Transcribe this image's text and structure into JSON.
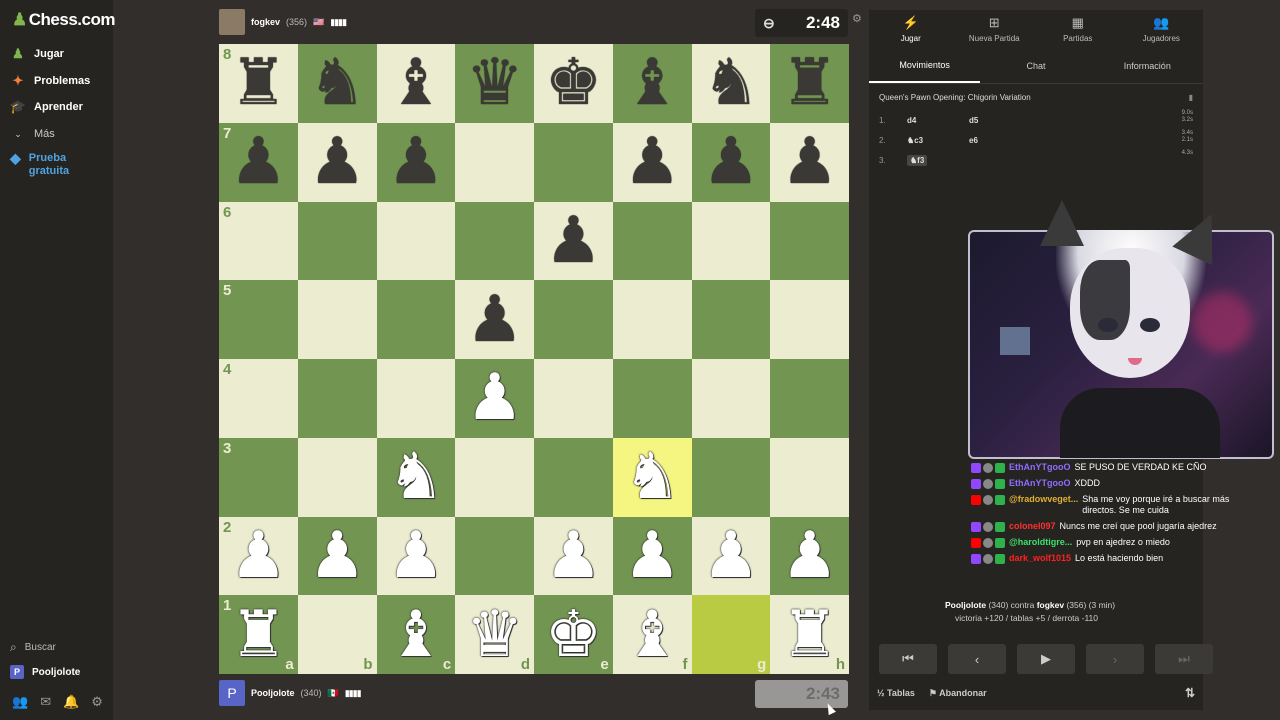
{
  "sidebar": {
    "logo": "Chess.com",
    "items": [
      {
        "label": "Jugar",
        "icon": "play-icon"
      },
      {
        "label": "Problemas",
        "icon": "puzzle-icon"
      },
      {
        "label": "Aprender",
        "icon": "learn-icon"
      },
      {
        "label": "Más",
        "icon": "chevron-down-icon"
      }
    ],
    "trial": "Prueba gratuita",
    "search": "Buscar",
    "user": "Pooljolote",
    "user_initial": "P"
  },
  "top_player": {
    "name": "fogkev",
    "rating": "(356)",
    "flag": "🇺🇸",
    "clock": "2:48"
  },
  "bottom_player": {
    "name": "Pooljolote",
    "rating": "(340)",
    "flag": "🇲🇽",
    "initial": "P",
    "clock": "2:43"
  },
  "board": {
    "ranks": [
      "8",
      "7",
      "6",
      "5",
      "4",
      "3",
      "2",
      "1"
    ],
    "files": [
      "a",
      "b",
      "c",
      "d",
      "e",
      "f",
      "g",
      "h"
    ],
    "position": [
      [
        "br",
        "bn",
        "bb",
        "bq",
        "bk",
        "bb",
        "bn",
        "br"
      ],
      [
        "bp",
        "bp",
        "bp",
        "",
        "",
        "bp",
        "bp",
        "bp"
      ],
      [
        "",
        "",
        "",
        "",
        "bp",
        "",
        "",
        ""
      ],
      [
        "",
        "",
        "",
        "bp",
        "",
        "",
        "",
        ""
      ],
      [
        "",
        "",
        "",
        "wp",
        "",
        "",
        "",
        ""
      ],
      [
        "",
        "",
        "wn",
        "",
        "",
        "wn",
        "",
        ""
      ],
      [
        "wp",
        "wp",
        "wp",
        "",
        "wp",
        "wp",
        "wp",
        "wp"
      ],
      [
        "wr",
        "",
        "wb",
        "wq",
        "wk",
        "wb",
        "",
        "wr"
      ]
    ],
    "highlight": [
      [
        5,
        5
      ],
      [
        7,
        6
      ]
    ]
  },
  "panel": {
    "tabs": [
      {
        "label": "Jugar",
        "icon": "bolt-icon"
      },
      {
        "label": "Nueva Partida",
        "icon": "plus-icon"
      },
      {
        "label": "Partidas",
        "icon": "board-icon"
      },
      {
        "label": "Jugadores",
        "icon": "players-icon"
      }
    ],
    "subtabs": [
      "Movimientos",
      "Chat",
      "Información"
    ],
    "opening": "Queen's Pawn Opening: Chigorin Variation",
    "moves": [
      {
        "num": "1.",
        "white": "d4",
        "black": "d5",
        "times": [
          "9.0s",
          "3.2s"
        ]
      },
      {
        "num": "2.",
        "white": "♞c3",
        "black": "e6",
        "times": [
          "3.4s",
          "2.1s"
        ]
      },
      {
        "num": "3.",
        "white": "♞f3",
        "black": "",
        "times": [
          "4.3s"
        ]
      }
    ],
    "draw": "Tablas",
    "resign": "Abandonar"
  },
  "chat": [
    {
      "user": "EthAnYTgooO",
      "color": "#8f6cff",
      "msg": "SE PUSO DE VERDAD KE CÑO",
      "platform": "twitch"
    },
    {
      "user": "EthAnYTgooO",
      "color": "#8f6cff",
      "msg": "XDDD",
      "platform": "twitch"
    },
    {
      "user": "@fradowveget...",
      "color": "#e0b034",
      "msg": "Sha me voy porque iré a buscar más directos. Se me cuida",
      "platform": "youtube"
    },
    {
      "user": "colonel097",
      "color": "#ff3030",
      "msg": "Nuncs me creí que pool jugaría ajedrez",
      "platform": "twitch"
    },
    {
      "user": "@haroldtigre...",
      "color": "#3ce06a",
      "msg": "pvp en ajedrez o miedo",
      "platform": "youtube"
    },
    {
      "user": "dark_wolf1015",
      "color": "#ff2020",
      "msg": "Lo está haciendo bien",
      "platform": "twitch"
    }
  ],
  "summary": {
    "line1_a": "Pooljolote",
    "line1_b": "(340) contra",
    "line1_c": "fogkev",
    "line1_d": "(356) (3 min)",
    "line2": "victoria +120 / tablas +5 / derrota -110"
  }
}
